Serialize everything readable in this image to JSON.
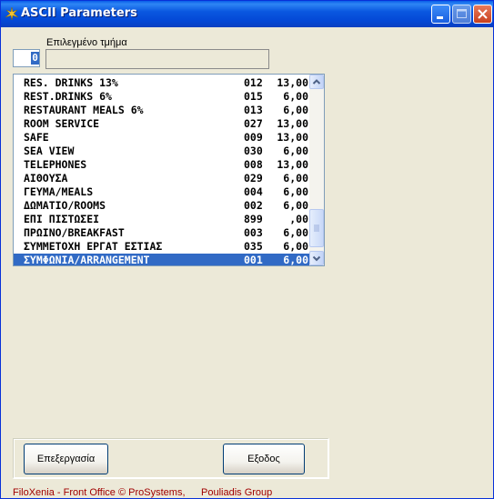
{
  "window": {
    "title": "ASCII Parameters",
    "icon": "xenia-logo-icon",
    "controls": [
      "minimize-icon",
      "maximize-icon",
      "close-icon"
    ]
  },
  "department": {
    "label": "Επιλεγμένο τμήμα",
    "code_value": "0",
    "name_value": ""
  },
  "list": {
    "rows": [
      {
        "name": "RES. DRINKS 13%",
        "code": "012",
        "rate": "13,00"
      },
      {
        "name": "REST.DRINKS 6%",
        "code": "015",
        "rate": "6,00"
      },
      {
        "name": "RESTAURANT MEALS 6%",
        "code": "013",
        "rate": "6,00"
      },
      {
        "name": "ROOM SERVICE",
        "code": "027",
        "rate": "13,00"
      },
      {
        "name": "SAFE",
        "code": "009",
        "rate": "13,00"
      },
      {
        "name": "SEA VIEW",
        "code": "030",
        "rate": "6,00"
      },
      {
        "name": "TELEPHONES",
        "code": "008",
        "rate": "13,00"
      },
      {
        "name": "ΑΙΘΟΥΣΑ",
        "code": "029",
        "rate": "6,00"
      },
      {
        "name": "ΓΕΥΜΑ/MEALS",
        "code": "004",
        "rate": "6,00"
      },
      {
        "name": "ΔΩΜΑΤΙΟ/ROOMS",
        "code": "002",
        "rate": "6,00"
      },
      {
        "name": "ΕΠΙ ΠΙΣΤΩΣΕΙ",
        "code": "899",
        "rate": ",00"
      },
      {
        "name": "ΠΡΩΙΝΟ/BREAKFAST",
        "code": "003",
        "rate": "6,00"
      },
      {
        "name": "ΣΥΜΜΕΤΟΧΗ ΕΡΓΑΤ ΕΣΤΙΑΣ",
        "code": "035",
        "rate": "6,00"
      },
      {
        "name": "ΣΥΜΦΩΝΙΑ/ARRANGEMENT",
        "code": "001",
        "rate": "6,00"
      }
    ],
    "selected_index": 13,
    "scroll_position": 0.93
  },
  "buttons": {
    "edit_label": "Επεξεργασία",
    "exit_label": "Εξοδος"
  },
  "footer": {
    "product": "FiloXenia - Front Office",
    "copyright": "© ProSystems,",
    "company": "Pouliadis Group"
  },
  "colors": {
    "titlebar": "#0A58E0",
    "selection": "#316AC5",
    "window_bg": "#ECE9D8",
    "footer_text": "#A00000"
  }
}
